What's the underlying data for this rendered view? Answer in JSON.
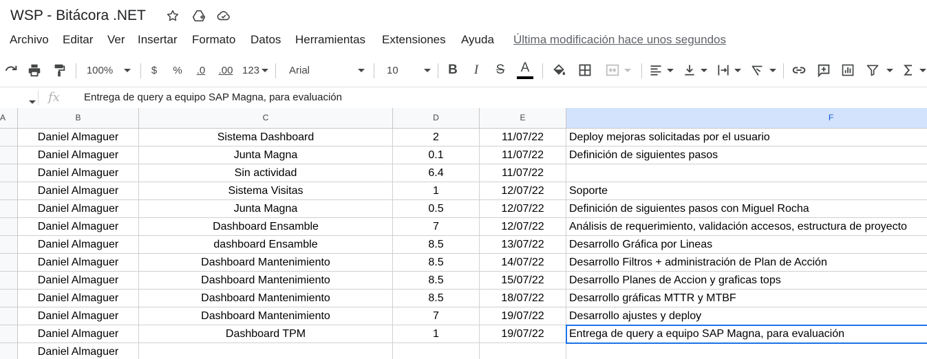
{
  "title": "WSP - Bitácora .NET",
  "menu": [
    "Archivo",
    "Editar",
    "Ver",
    "Insertar",
    "Formato",
    "Datos",
    "Herramientas",
    "Extensiones",
    "Ayuda"
  ],
  "last_edit": "Última modificación hace unos segundos",
  "toolbar": {
    "zoom": "100%",
    "currency": "$",
    "percent": "%",
    "decrease_decimals": ".0",
    "increase_decimals": ".00",
    "more_formats": "123",
    "font": "Arial",
    "font_size": "10",
    "bold": "B",
    "italic": "I",
    "strikethrough": "S",
    "text_color": "A"
  },
  "formula_bar": {
    "fx": "fx",
    "content": "Entrega de query a equipo SAP Magna, para evaluación"
  },
  "columns": [
    "A",
    "B",
    "C",
    "D",
    "E",
    "F"
  ],
  "rows": [
    {
      "b": "Daniel Almaguer",
      "c": "Sistema Dashboard",
      "d": "2",
      "e": "11/07/22",
      "f": "Deploy mejoras solicitadas por el usuario"
    },
    {
      "b": "Daniel Almaguer",
      "c": "Junta Magna",
      "d": "0.1",
      "e": "11/07/22",
      "f": "Definición de siguientes pasos"
    },
    {
      "b": "Daniel Almaguer",
      "c": "Sin actividad",
      "d": "6.4",
      "e": "11/07/22",
      "f": ""
    },
    {
      "b": "Daniel Almaguer",
      "c": "Sistema Visitas",
      "d": "1",
      "e": "12/07/22",
      "f": "Soporte"
    },
    {
      "b": "Daniel Almaguer",
      "c": "Junta Magna",
      "d": "0.5",
      "e": "12/07/22",
      "f": "Definición de siguientes pasos con Miguel Rocha"
    },
    {
      "b": "Daniel Almaguer",
      "c": "Dashboard Ensamble",
      "d": "7",
      "e": "12/07/22",
      "f": "Análisis de requerimiento, validación accesos,  estructura de proyecto"
    },
    {
      "b": "Daniel Almaguer",
      "c": "dashboard Ensamble",
      "d": "8.5",
      "e": "13/07/22",
      "f": "Desarrollo Gráfica por Lineas"
    },
    {
      "b": "Daniel Almaguer",
      "c": "Dashboard Mantenimiento",
      "d": "8.5",
      "e": "14/07/22",
      "f": "Desarrollo Filtros + administración de Plan de Acción"
    },
    {
      "b": "Daniel Almaguer",
      "c": "Dashboard Mantenimiento",
      "d": "8.5",
      "e": "15/07/22",
      "f": "Desarrollo Planes de Accion y graficas tops"
    },
    {
      "b": "Daniel Almaguer",
      "c": "Dashboard Mantenimiento",
      "d": "8.5",
      "e": "18/07/22",
      "f": "Desarrollo gráficas MTTR y MTBF"
    },
    {
      "b": "Daniel Almaguer",
      "c": "Dashboard Mantenimiento",
      "d": "7",
      "e": "19/07/22",
      "f": "Desarrollo ajustes y deploy"
    },
    {
      "b": "Daniel Almaguer",
      "c": "Dashboard TPM",
      "d": "1",
      "e": "19/07/22",
      "f": "Entrega de query a equipo SAP Magna, para evaluación"
    },
    {
      "b": "Daniel Almaguer",
      "c": "",
      "d": "",
      "e": "",
      "f": ""
    }
  ],
  "colors": {
    "selection": "#1a73e8",
    "header_bg": "#f8f9fa",
    "active_header_bg": "#d3e3fd"
  }
}
